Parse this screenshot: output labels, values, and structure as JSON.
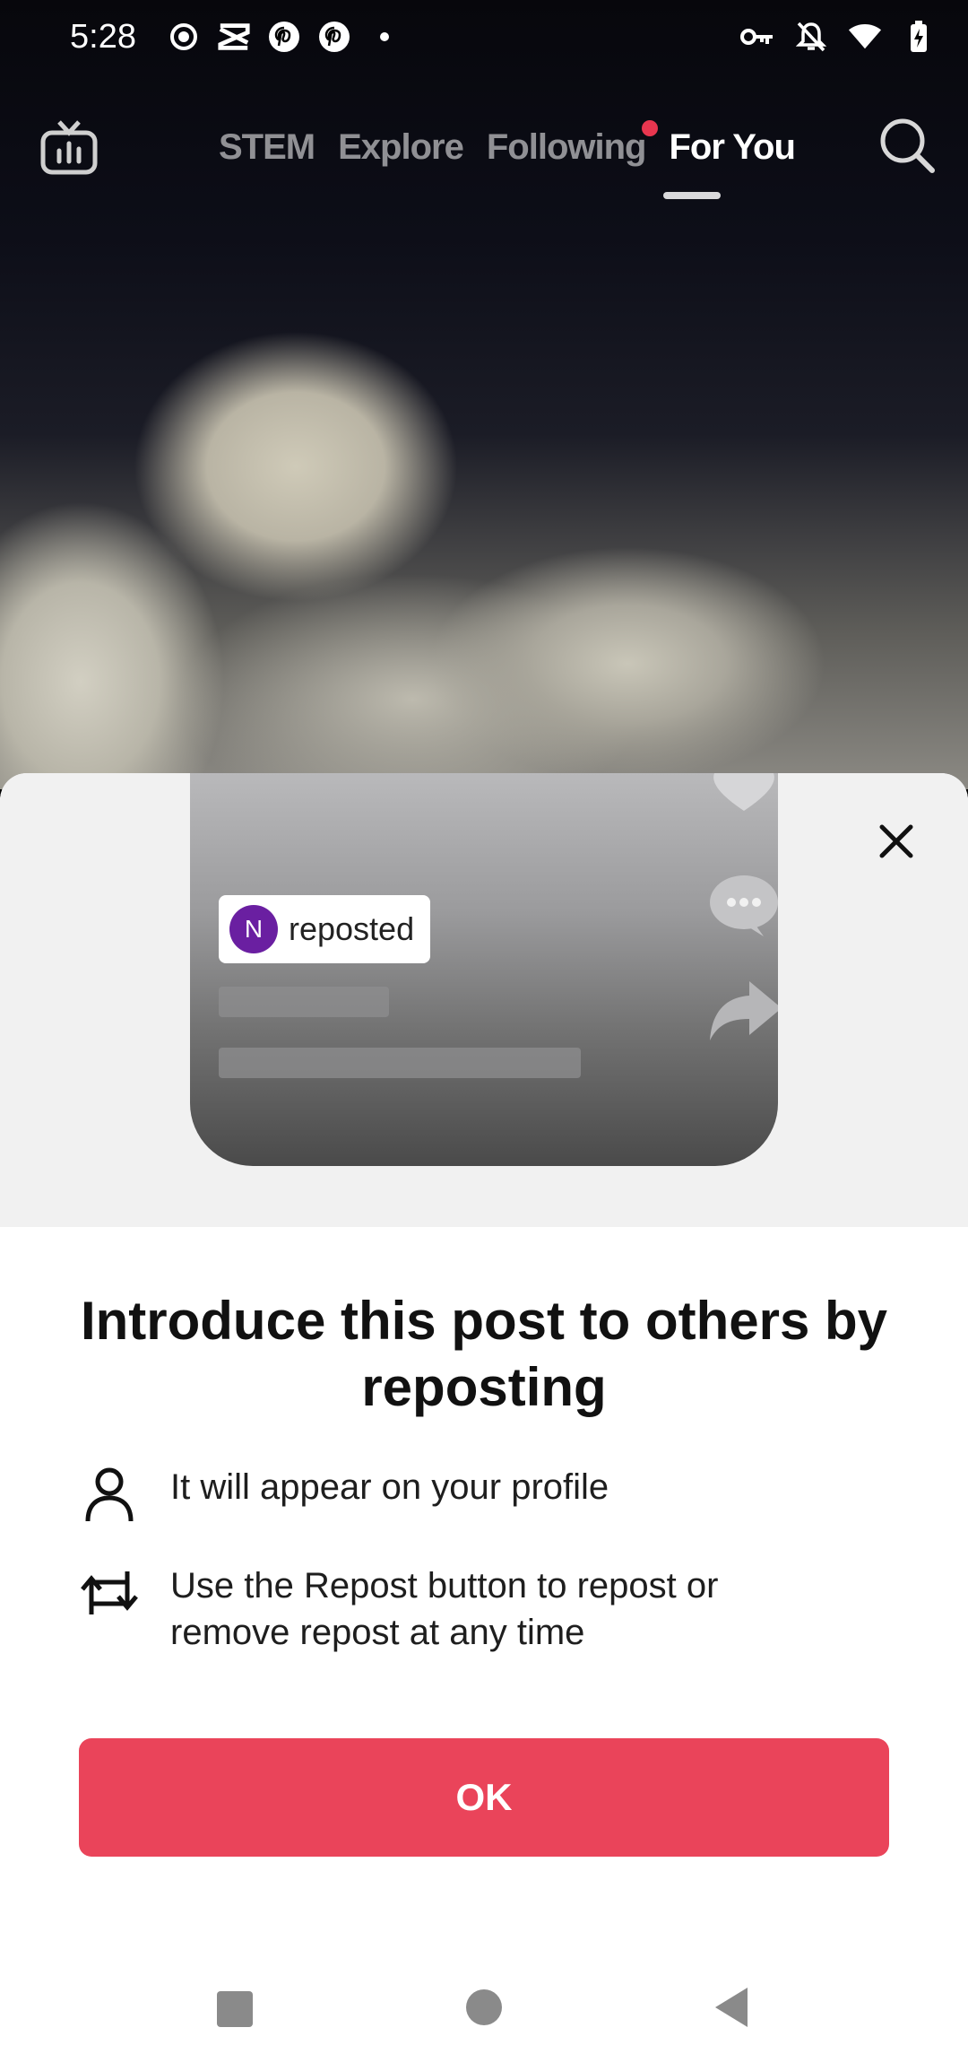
{
  "status_bar": {
    "time": "5:28",
    "left_icons": [
      "record-icon",
      "capcut-icon",
      "pinterest-icon",
      "pinterest-icon",
      "dot-icon"
    ],
    "right_icons": [
      "vpn-key-icon",
      "bell-off-icon",
      "wifi-icon",
      "battery-charging-icon"
    ]
  },
  "top_nav": {
    "tabs": [
      {
        "label": "STEM"
      },
      {
        "label": "Explore"
      },
      {
        "label": "Following"
      },
      {
        "label": "For You"
      }
    ],
    "active_tab": "For You"
  },
  "preview": {
    "avatar_letter": "N",
    "chip_label": "reposted"
  },
  "sheet": {
    "title": "Introduce this post to others by reposting",
    "items": [
      {
        "icon": "user-icon",
        "text": "It will appear on your profile"
      },
      {
        "icon": "repost-icon",
        "text": "Use the Repost button to repost or remove repost at any time"
      }
    ],
    "ok_label": "OK"
  },
  "colors": {
    "accent": "#ea445a",
    "avatar": "#6a1fa1",
    "notification_dot": "#e8364f"
  }
}
